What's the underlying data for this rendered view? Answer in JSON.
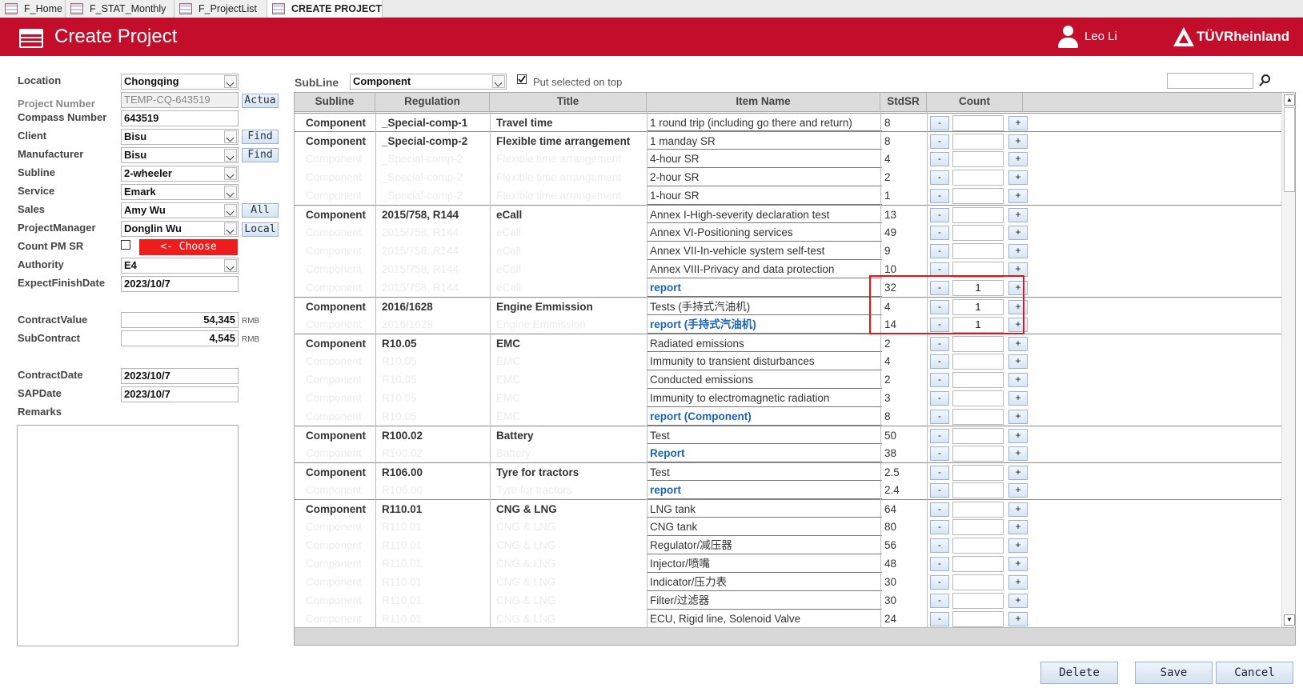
{
  "tabs": [
    {
      "label": "F_Home",
      "active": false
    },
    {
      "label": "F_STAT_Monthly",
      "active": false
    },
    {
      "label": "F_ProjectList",
      "active": false
    },
    {
      "label": "CREATE PROJECT",
      "active": true
    }
  ],
  "header": {
    "title": "Create Project",
    "user": "Leo Li",
    "brand": "TÜVRheinland"
  },
  "form": {
    "location": {
      "label": "Location",
      "value": "Chongqing"
    },
    "project_number": {
      "label": "Project Number",
      "value": "TEMP-CQ-643519",
      "button": "Actua"
    },
    "compass_number": {
      "label": "Compass Number",
      "value": "643519"
    },
    "client": {
      "label": "Client",
      "value": "Bisu",
      "button": "Find"
    },
    "manufacturer": {
      "label": "Manufacturer",
      "value": "Bisu",
      "button": "Find"
    },
    "subline": {
      "label": "Subline",
      "value": "2-wheeler"
    },
    "service": {
      "label": "Service",
      "value": "Emark"
    },
    "sales": {
      "label": "Sales",
      "value": "Amy Wu",
      "button": "All"
    },
    "project_manager": {
      "label": "ProjectManager",
      "value": "Donglin Wu",
      "button": "Local"
    },
    "count_pm_sr": {
      "label": "Count PM SR",
      "checked": false,
      "button": "<- Choose"
    },
    "authority": {
      "label": "Authority",
      "value": "E4"
    },
    "expect_finish_date": {
      "label": "ExpectFinishDate",
      "value": "2023/10/7"
    },
    "contract_value": {
      "label": "ContractValue",
      "value": "54,345",
      "unit": "RMB"
    },
    "subcontract": {
      "label": "SubContract",
      "value": "4,545",
      "unit": "RMB"
    },
    "contract_date": {
      "label": "ContractDate",
      "value": "2023/10/7"
    },
    "sap_date": {
      "label": "SAPDate",
      "value": "2023/10/7"
    },
    "remarks": {
      "label": "Remarks",
      "value": ""
    }
  },
  "panel": {
    "subline_label": "SubLine",
    "subline_value": "Component",
    "put_selected_label": "Put selected on top",
    "put_selected_checked": true,
    "search_value": ""
  },
  "grid": {
    "columns": [
      "Subline",
      "Regulation",
      "Title",
      "Item Name",
      "StdSR",
      "Count"
    ],
    "minus": "-",
    "plus": "+",
    "rows": [
      {
        "subline": "Component",
        "regulation": "_Special-comp-1",
        "title": "Travel time",
        "item": "1 round trip (including go there and return)",
        "stdsr": "8",
        "count": "",
        "group": true,
        "link": false
      },
      {
        "subline": "Component",
        "regulation": "_Special-comp-2",
        "title": "Flexible time arrangement",
        "item": "1 manday SR",
        "stdsr": "8",
        "count": "",
        "group": true,
        "link": false
      },
      {
        "subline": "Component",
        "regulation": "_Special-comp-2",
        "title": "Flexible time arrangement",
        "item": "4-hour SR",
        "stdsr": "4",
        "count": "",
        "group": false,
        "link": false
      },
      {
        "subline": "Component",
        "regulation": "_Special-comp-2",
        "title": "Flexible time arrangement",
        "item": "2-hour SR",
        "stdsr": "2",
        "count": "",
        "group": false,
        "link": false
      },
      {
        "subline": "Component",
        "regulation": "_Special-comp-2",
        "title": "Flexible time arrangement",
        "item": "1-hour SR",
        "stdsr": "1",
        "count": "",
        "group": false,
        "link": false
      },
      {
        "subline": "Component",
        "regulation": "2015/758, R144",
        "title": "eCall",
        "item": "Annex I-High-severity declaration test",
        "stdsr": "13",
        "count": "",
        "group": true,
        "link": false
      },
      {
        "subline": "Component",
        "regulation": "2015/758, R144",
        "title": "eCall",
        "item": "Annex VI-Positioning services",
        "stdsr": "49",
        "count": "",
        "group": false,
        "link": false
      },
      {
        "subline": "Component",
        "regulation": "2015/758, R144",
        "title": "eCall",
        "item": "Annex VII-In-vehicle system self-test",
        "stdsr": "9",
        "count": "",
        "group": false,
        "link": false
      },
      {
        "subline": "Component",
        "regulation": "2015/758, R144",
        "title": "eCall",
        "item": "Annex VIII-Privacy and data protection",
        "stdsr": "10",
        "count": "",
        "group": false,
        "link": false
      },
      {
        "subline": "Component",
        "regulation": "2015/758, R144",
        "title": "eCall",
        "item": "report",
        "stdsr": "32",
        "count": "1",
        "group": false,
        "link": true
      },
      {
        "subline": "Component",
        "regulation": "2016/1628",
        "title": "Engine Emmission",
        "item": "Tests (手持式汽油机)",
        "stdsr": "4",
        "count": "1",
        "group": true,
        "link": false
      },
      {
        "subline": "Component",
        "regulation": "2016/1628",
        "title": "Engine Emmission",
        "item": "report (手持式汽油机)",
        "stdsr": "14",
        "count": "1",
        "group": false,
        "link": true
      },
      {
        "subline": "Component",
        "regulation": "R10.05",
        "title": "EMC",
        "item": "Radiated emissions",
        "stdsr": "2",
        "count": "",
        "group": true,
        "link": false
      },
      {
        "subline": "Component",
        "regulation": "R10.05",
        "title": "EMC",
        "item": "Immunity to transient disturbances",
        "stdsr": "4",
        "count": "",
        "group": false,
        "link": false
      },
      {
        "subline": "Component",
        "regulation": "R10.05",
        "title": "EMC",
        "item": "Conducted emissions",
        "stdsr": "2",
        "count": "",
        "group": false,
        "link": false
      },
      {
        "subline": "Component",
        "regulation": "R10.05",
        "title": "EMC",
        "item": "Immunity to electromagnetic radiation",
        "stdsr": "3",
        "count": "",
        "group": false,
        "link": false
      },
      {
        "subline": "Component",
        "regulation": "R10.05",
        "title": "EMC",
        "item": "report (Component)",
        "stdsr": "8",
        "count": "",
        "group": false,
        "link": true
      },
      {
        "subline": "Component",
        "regulation": "R100.02",
        "title": "Battery",
        "item": "Test",
        "stdsr": "50",
        "count": "",
        "group": true,
        "link": false
      },
      {
        "subline": "Component",
        "regulation": "R100.02",
        "title": "Battery",
        "item": "Report",
        "stdsr": "38",
        "count": "",
        "group": false,
        "link": true
      },
      {
        "subline": "Component",
        "regulation": "R106.00",
        "title": "Tyre for tractors",
        "item": "Test",
        "stdsr": "2.5",
        "count": "",
        "group": true,
        "link": false
      },
      {
        "subline": "Component",
        "regulation": "R106.00",
        "title": "Tyre for tractors",
        "item": "report",
        "stdsr": "2.4",
        "count": "",
        "group": false,
        "link": true
      },
      {
        "subline": "Component",
        "regulation": "R110.01",
        "title": "CNG & LNG",
        "item": "LNG tank",
        "stdsr": "64",
        "count": "",
        "group": true,
        "link": false
      },
      {
        "subline": "Component",
        "regulation": "R110.01",
        "title": "CNG & LNG",
        "item": "CNG tank",
        "stdsr": "80",
        "count": "",
        "group": false,
        "link": false
      },
      {
        "subline": "Component",
        "regulation": "R110.01",
        "title": "CNG & LNG",
        "item": "Regulator/减压器",
        "stdsr": "56",
        "count": "",
        "group": false,
        "link": false
      },
      {
        "subline": "Component",
        "regulation": "R110.01",
        "title": "CNG & LNG",
        "item": "Injector/喷嘴",
        "stdsr": "48",
        "count": "",
        "group": false,
        "link": false
      },
      {
        "subline": "Component",
        "regulation": "R110.01",
        "title": "CNG & LNG",
        "item": "Indicator/压力表",
        "stdsr": "30",
        "count": "",
        "group": false,
        "link": false
      },
      {
        "subline": "Component",
        "regulation": "R110.01",
        "title": "CNG & LNG",
        "item": "Filter/过滤器",
        "stdsr": "30",
        "count": "",
        "group": false,
        "link": false
      },
      {
        "subline": "Component",
        "regulation": "R110.01",
        "title": "CNG & LNG",
        "item": "ECU, Rigid line, Solenoid Valve",
        "stdsr": "24",
        "count": "",
        "group": false,
        "link": false
      }
    ]
  },
  "buttons": {
    "delete": "Delete",
    "save": "Save",
    "cancel": "Cancel"
  },
  "colors": {
    "brand_red": "#c20e2b",
    "link_blue": "#1a64b4",
    "highlight_red": "#ee1111"
  }
}
